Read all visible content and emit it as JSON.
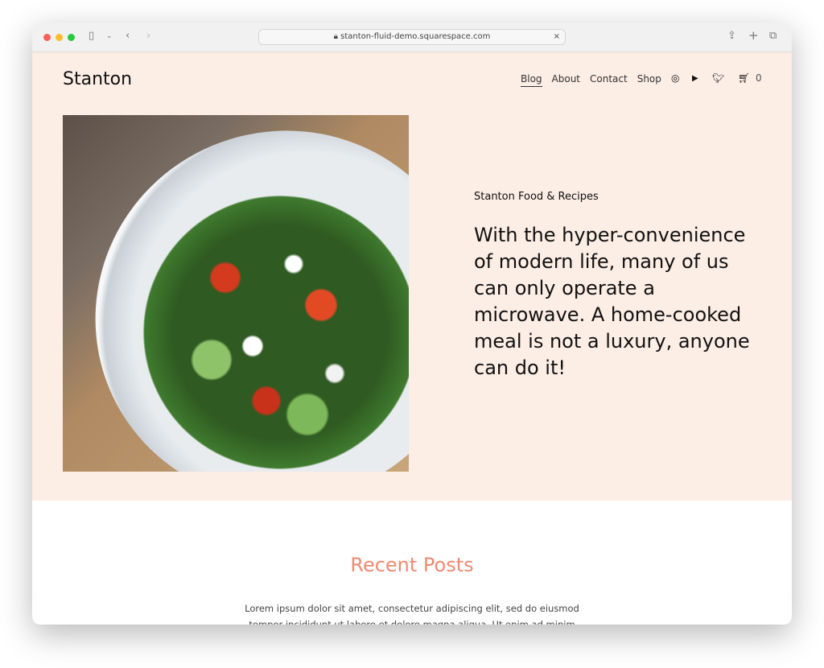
{
  "browser": {
    "url": "stanton-fluid-demo.squarespace.com"
  },
  "site": {
    "logo": "Stanton",
    "nav": [
      {
        "label": "Blog",
        "active": true
      },
      {
        "label": "About"
      },
      {
        "label": "Contact"
      },
      {
        "label": "Shop"
      }
    ],
    "social": [
      "instagram-icon",
      "youtube-icon",
      "twitter-icon"
    ],
    "cart_count": "0"
  },
  "hero": {
    "subtitle": "Stanton Food & Recipes",
    "headline": "With the hyper-convenience of modern life, many of us can only operate a microwave. A home-cooked meal is not a luxury, anyone can do it!",
    "background": "#fcede5"
  },
  "recent": {
    "title": "Recent Posts",
    "text": "Lorem ipsum dolor sit amet, consectetur adipiscing elit, sed do eiusmod tempor incididunt ut labore et dolore magna aliqua. Ut enim ad minim",
    "accent": "#ee8a72"
  }
}
